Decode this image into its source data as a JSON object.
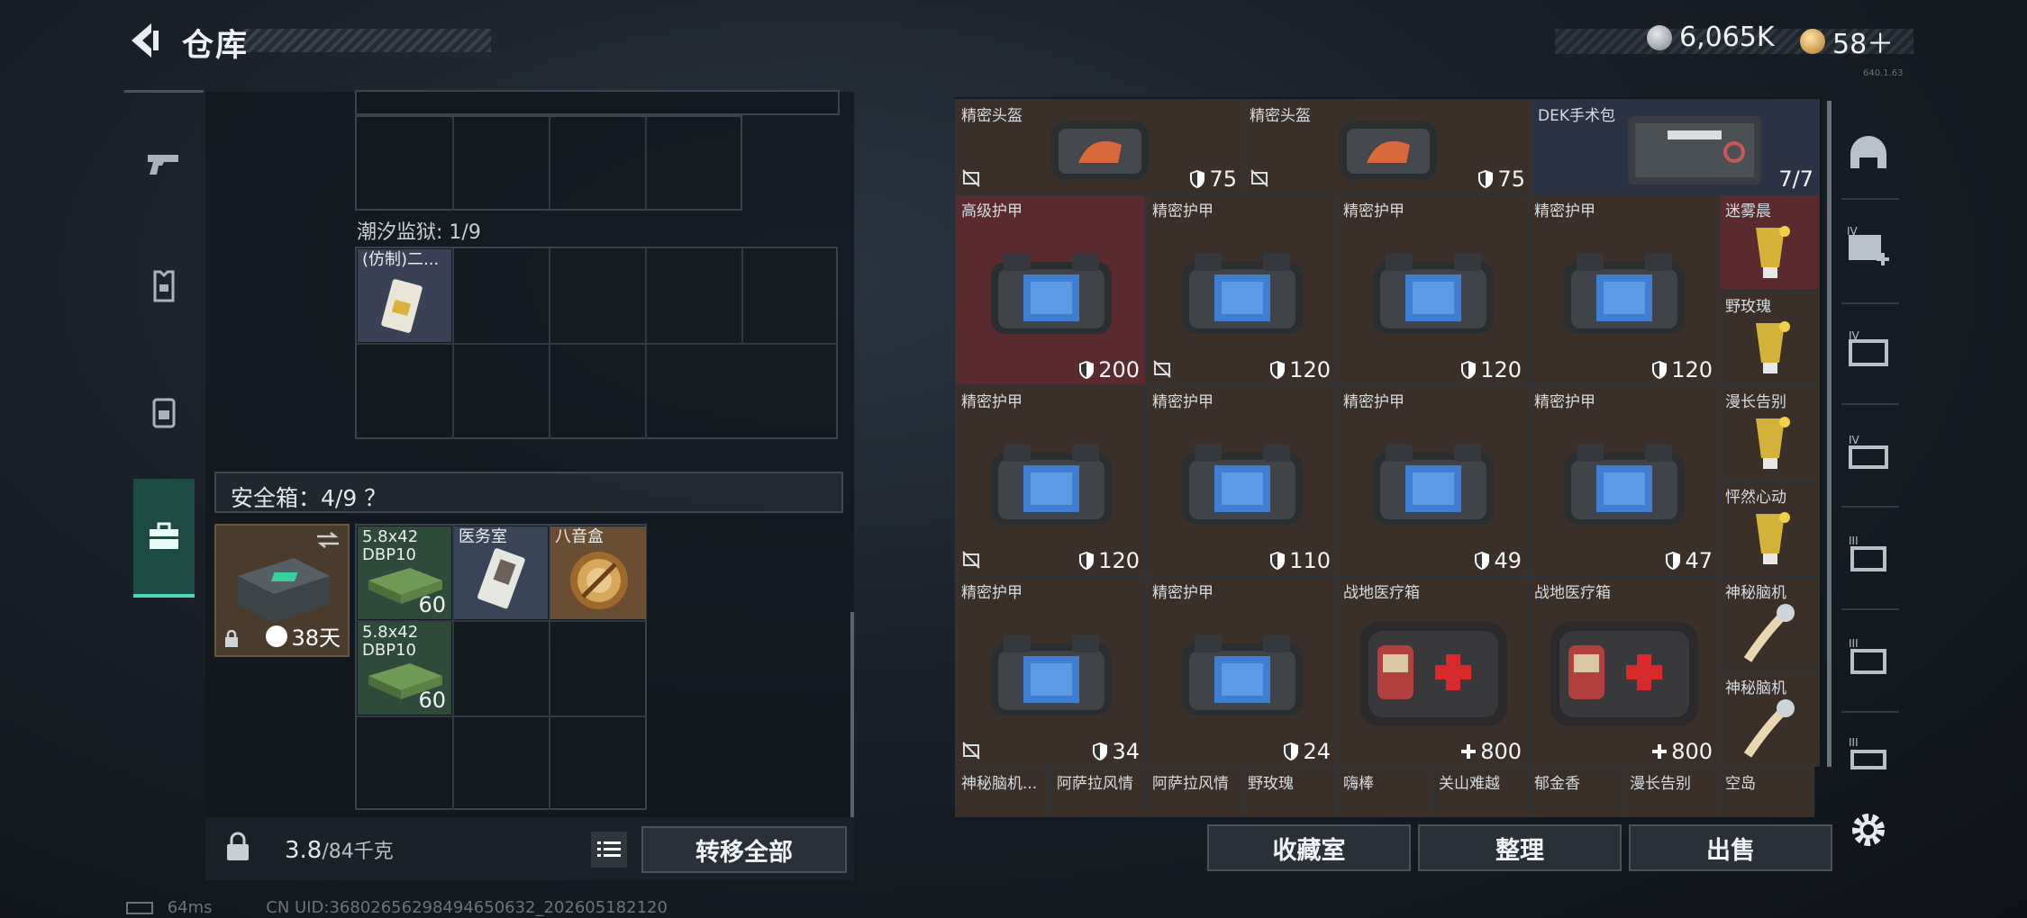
{
  "header": {
    "title": "仓库",
    "silver": "6,065K",
    "gold": "58＋",
    "version": "640.1.63"
  },
  "left_panel": {
    "prison_label": "潮汐监狱: 1/9",
    "prison_item": "(仿制)二...",
    "safe_label": "安全箱：4/9 ？",
    "case_days": "38天",
    "safe_items": [
      {
        "name": "5.8x42\nDBP10",
        "qty": "60"
      },
      {
        "name": "医务室",
        "qty": ""
      },
      {
        "name": "八音盒",
        "qty": ""
      },
      {
        "name": "5.8x42\nDBP10",
        "qty": "60"
      }
    ],
    "weight": "3.8",
    "weight_max": "/84千克",
    "transfer_all": "转移全部"
  },
  "right_panel": {
    "items": [
      {
        "name": "精密头盔",
        "value": "75"
      },
      {
        "name": "精密头盔",
        "value": "75"
      },
      {
        "name": "DEK手术包",
        "value": "7/7"
      },
      {
        "name": "高级护甲",
        "value": "200"
      },
      {
        "name": "精密护甲",
        "value": "120"
      },
      {
        "name": "精密护甲",
        "value": "120"
      },
      {
        "name": "精密护甲",
        "value": "120"
      },
      {
        "name": "迷雾晨"
      },
      {
        "name": "野玫瑰"
      },
      {
        "name": "精密护甲",
        "value": "120"
      },
      {
        "name": "精密护甲",
        "value": "110"
      },
      {
        "name": "精密护甲",
        "value": "49"
      },
      {
        "name": "精密护甲",
        "value": "47"
      },
      {
        "name": "漫长告别"
      },
      {
        "name": "怦然心动"
      },
      {
        "name": "精密护甲",
        "value": "34"
      },
      {
        "name": "精密护甲",
        "value": "24"
      },
      {
        "name": "战地医疗箱",
        "value": "800"
      },
      {
        "name": "战地医疗箱",
        "value": "800"
      },
      {
        "name": "神秘脑机"
      },
      {
        "name": "神秘脑机"
      }
    ],
    "bottom_row": [
      "神秘脑机...",
      "阿萨拉风情",
      "阿萨拉风情",
      "野玫瑰",
      "嗨棒",
      "关山难越",
      "郁金香",
      "漫长告别",
      "空岛"
    ],
    "buttons": {
      "collection": "收藏室",
      "sort": "整理",
      "sell": "出售"
    }
  },
  "footer": {
    "ping": "64ms",
    "uid": "CN UID:36802656298494650632_202605182120"
  }
}
